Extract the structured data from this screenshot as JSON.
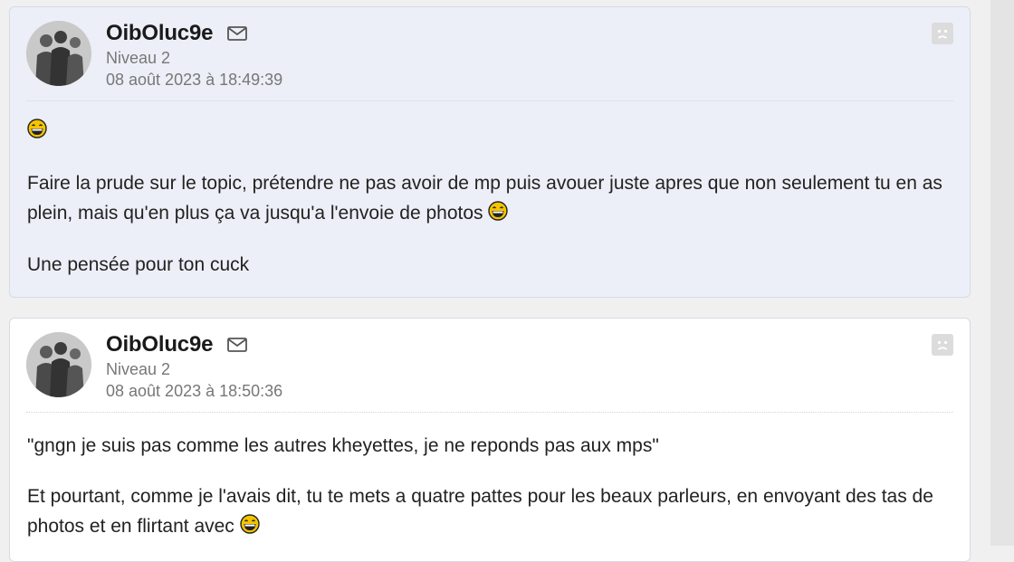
{
  "posts": [
    {
      "author": "OibOluc9e",
      "level": "Niveau 2",
      "date": "08 août 2023 à 18:49:39",
      "paragraphs": [
        "Faire la prude sur le topic, prétendre ne pas avoir de mp puis avouer juste apres que non seulement tu en as plein, mais qu'en plus ça va jusqu'a l'envoie de photos",
        "Une pensée pour ton cuck"
      ]
    },
    {
      "author": "OibOluc9e",
      "level": "Niveau 2",
      "date": "08 août 2023 à 18:50:36",
      "paragraphs": [
        "\"gngn je suis pas comme les autres kheyettes, je ne reponds pas aux mps\"",
        "Et pourtant, comme je l'avais dit, tu te mets a quatre pattes pour les beaux parleurs, en envoyant des tas de photos et en flirtant avec"
      ]
    }
  ],
  "icons": {
    "mail": "envelope-icon",
    "report": "sad-face-report-icon",
    "smiley": "laughing-smiley-icon"
  },
  "colors": {
    "highlight_bg": "#eceff7",
    "post_bg": "#ffffff",
    "meta_text": "#777777"
  }
}
